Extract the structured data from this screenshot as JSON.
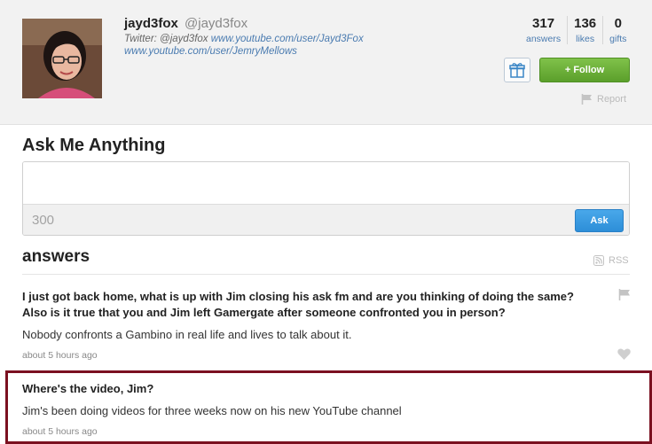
{
  "profile": {
    "username": "jayd3fox",
    "handle": "@jayd3fox",
    "bio_prefix": "Twitter: @jayd3fox",
    "bio_link1": "www.youtube.com/user/Jayd3Fox",
    "bio_link2": "www.youtube.com/user/JemryMellows",
    "avatar_icon": "user-photo"
  },
  "stats": [
    {
      "value": "317",
      "label": "answers"
    },
    {
      "value": "136",
      "label": "likes"
    },
    {
      "value": "0",
      "label": "gifts"
    }
  ],
  "actions": {
    "gift_icon": "gift-icon",
    "follow_label": "+ Follow",
    "report_label": "Report"
  },
  "ask": {
    "title": "Ask Me Anything",
    "input_value": "",
    "counter": "300",
    "button_label": "Ask"
  },
  "answers": {
    "title": "answers",
    "rss_label": "RSS",
    "items": [
      {
        "question": "I just got back home, what is up with Jim closing his ask fm and are you thinking of doing the same? Also is it true that you and Jim left Gamergate after someone confronted you in person?",
        "answer": "Nobody confronts a Gambino in real life and lives to talk about it.",
        "time": "about 5 hours ago"
      },
      {
        "question": "Where's the video, Jim?",
        "answer": "Jim's been doing videos for three weeks now on his new YouTube channel",
        "time": "about 5 hours ago"
      }
    ]
  },
  "colors": {
    "follow": "#6db23a",
    "ask": "#3a9ae2",
    "highlight_border": "#7b1020",
    "link": "#4a7bb0"
  }
}
